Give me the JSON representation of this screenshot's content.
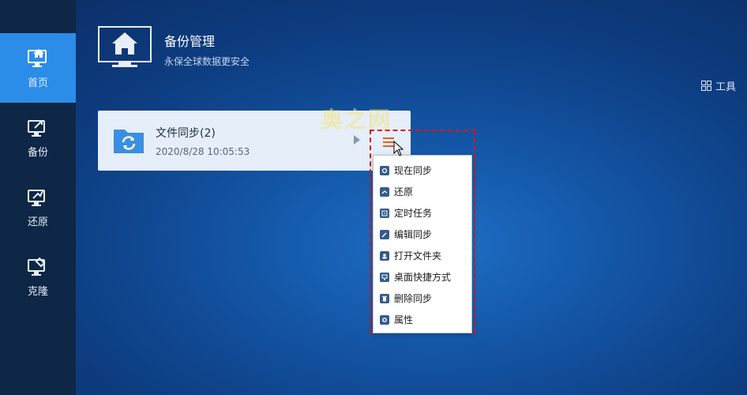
{
  "sidebar": {
    "items": [
      {
        "label": "首页",
        "icon": "home-monitor-icon",
        "active": true
      },
      {
        "label": "备份",
        "icon": "backup-monitor-icon",
        "active": false
      },
      {
        "label": "还原",
        "icon": "restore-monitor-icon",
        "active": false
      },
      {
        "label": "克隆",
        "icon": "clone-monitor-icon",
        "active": false
      }
    ]
  },
  "header": {
    "title": "备份管理",
    "subtitle": "永保全球数据更安全",
    "icon": "home-screen-icon"
  },
  "toolbar": {
    "tools_label": "工具",
    "tools_icon": "grid-icon"
  },
  "task_card": {
    "title": "文件同步(2)",
    "time": "2020/8/28 10:05:53",
    "icon": "sync-folder-icon"
  },
  "watermark": "奥之网",
  "context_menu": {
    "items": [
      {
        "label": "现在同步",
        "icon": "sync-now-icon"
      },
      {
        "label": "还原",
        "icon": "restore-icon"
      },
      {
        "label": "定时任务",
        "icon": "schedule-icon"
      },
      {
        "label": "编辑同步",
        "icon": "edit-icon"
      },
      {
        "label": "打开文件夹",
        "icon": "open-folder-icon"
      },
      {
        "label": "桌面快捷方式",
        "icon": "desktop-shortcut-icon"
      },
      {
        "label": "删除同步",
        "icon": "delete-icon"
      },
      {
        "label": "属性",
        "icon": "settings-gear-icon"
      }
    ]
  },
  "colors": {
    "accent": "#2b8de8",
    "sidebar_bg": "#0e2746",
    "menu_trigger": "#e0621f",
    "highlight_border": "#d41a1a"
  }
}
